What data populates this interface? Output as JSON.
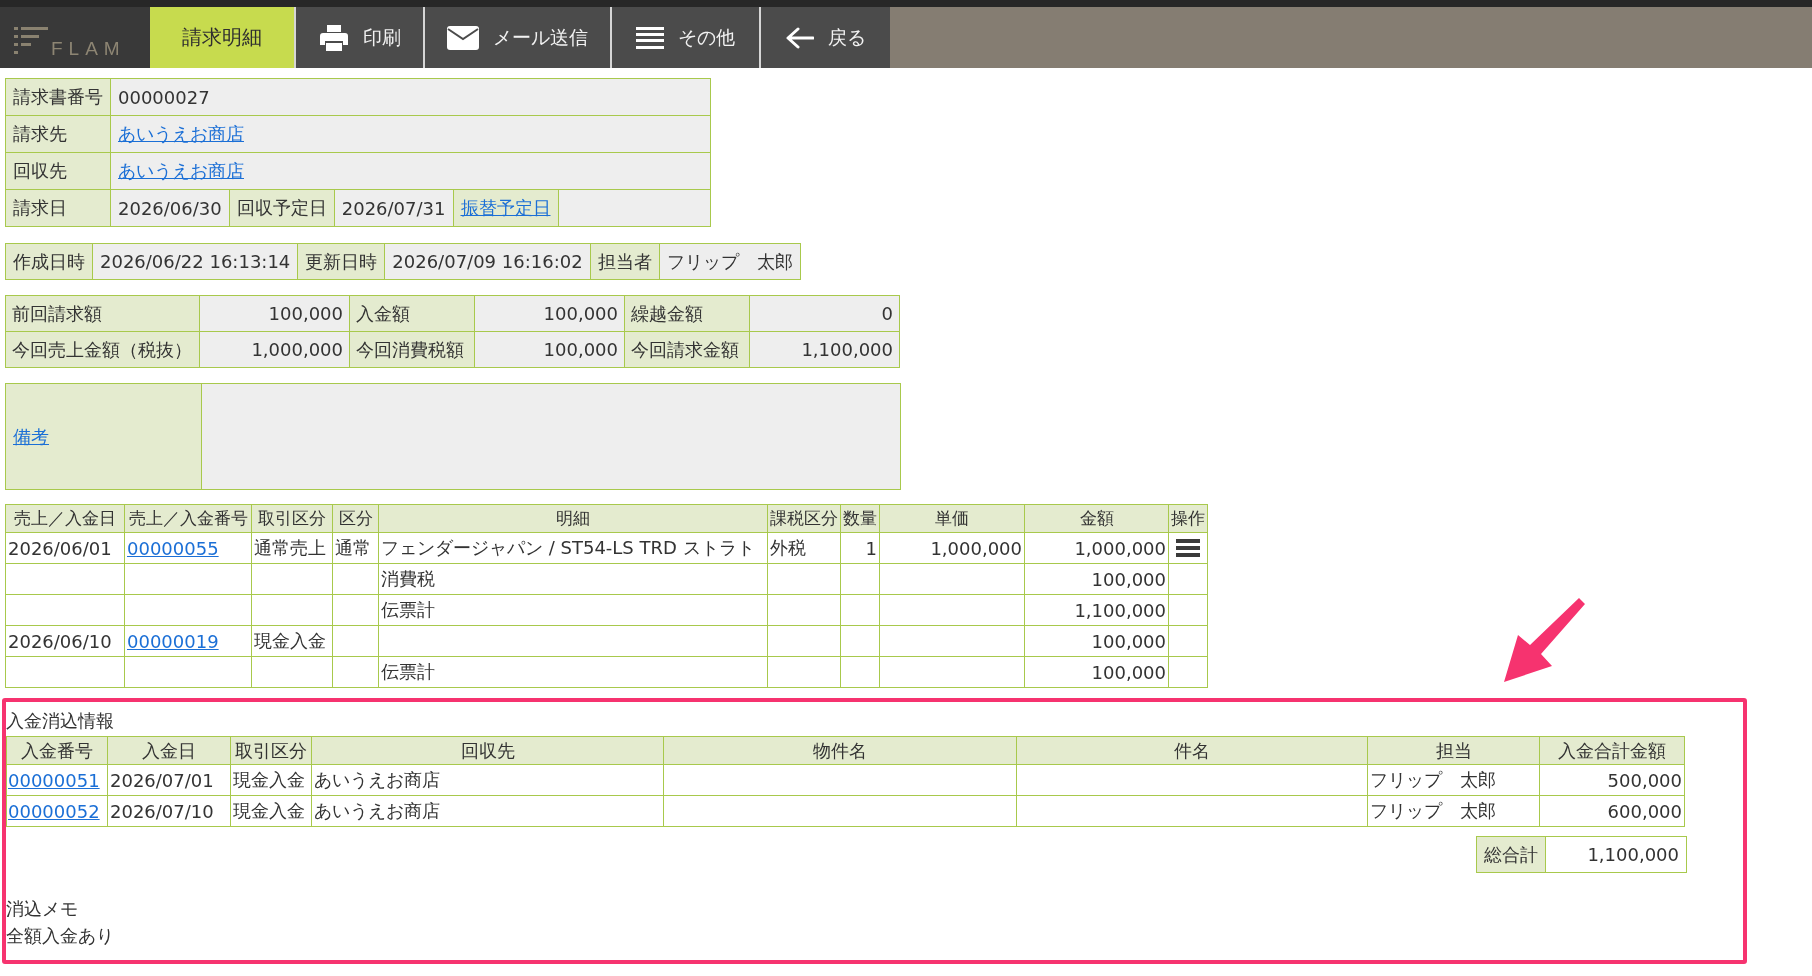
{
  "toolbar": {
    "logo": "FLAM",
    "tab": {
      "label": "請求明細",
      "selected": true
    },
    "buttons": [
      {
        "kind": "print",
        "label": "印刷"
      },
      {
        "kind": "mail",
        "label": "メール送信"
      },
      {
        "kind": "more",
        "label": "その他"
      },
      {
        "kind": "back",
        "label": "戻る"
      }
    ]
  },
  "invoice": {
    "rows": [
      [
        {
          "kind": "label",
          "text": "請求書番号"
        },
        {
          "kind": "value",
          "text": "00000027",
          "colspan": 5
        }
      ],
      [
        {
          "kind": "label",
          "text": "請求先"
        },
        {
          "kind": "link",
          "text": "あいうえお商店",
          "colspan": 5
        }
      ],
      [
        {
          "kind": "label",
          "text": "回収先"
        },
        {
          "kind": "link",
          "text": "あいうえお商店",
          "colspan": 5
        }
      ],
      [
        {
          "kind": "label",
          "text": "請求日"
        },
        {
          "kind": "value",
          "text": "2026/06/30"
        },
        {
          "kind": "label",
          "text": "回収予定日"
        },
        {
          "kind": "value",
          "text": "2026/07/31"
        },
        {
          "kind": "link_label",
          "text": "振替予定日"
        },
        {
          "kind": "value"
        }
      ]
    ]
  },
  "record": [
    {
      "kind": "label",
      "text": "作成日時"
    },
    {
      "kind": "value",
      "text": "2026/06/22 16:13:14"
    },
    {
      "kind": "label",
      "text": "更新日時"
    },
    {
      "kind": "value",
      "text": "2026/07/09 16:16:02"
    },
    {
      "kind": "label",
      "text": "担当者"
    },
    {
      "kind": "value",
      "text": "フリップ　太郎"
    }
  ],
  "totals": {
    "rows": [
      [
        {
          "kind": "label",
          "text": "前回請求額"
        },
        {
          "kind": "amount",
          "text": "100,000"
        },
        {
          "kind": "label",
          "text": "入金額"
        },
        {
          "kind": "amount",
          "text": "100,000"
        },
        {
          "kind": "label",
          "text": "繰越金額"
        },
        {
          "kind": "amount",
          "text": "0"
        }
      ],
      [
        {
          "kind": "label",
          "text": "今回売上金額（税抜）"
        },
        {
          "kind": "amount",
          "text": "1,000,000"
        },
        {
          "kind": "label",
          "text": "今回消費税額"
        },
        {
          "kind": "amount",
          "text": "100,000"
        },
        {
          "kind": "label",
          "text": "今回請求金額"
        },
        {
          "kind": "amount",
          "text": "1,100,000"
        }
      ]
    ]
  },
  "remarks": {
    "label": "備考"
  },
  "lines": {
    "columns": [
      "売上／入金日",
      "売上／入金番号",
      "取引区分",
      "区分",
      "明細",
      "課税区分",
      "数量",
      "単価",
      "金額",
      "操作"
    ],
    "rows": [
      {
        "date": "2026/06/01",
        "number": "00000055",
        "deal_type": "通常売上",
        "category": "通常",
        "item": "フェンダージャパン / ST54-LS TRD ストラト",
        "tax_type": "外税",
        "quantity": "1",
        "unit_price": "1,000,000",
        "amount": "1,000,000",
        "menu": true
      },
      {
        "item": "消費税",
        "amount": "100,000",
        "menu": false
      },
      {
        "item": "伝票計",
        "amount": "1,100,000",
        "menu": false
      },
      {
        "date": "2026/06/10",
        "number": "00000019",
        "deal_type": "現金入金",
        "amount": "100,000",
        "menu": false
      },
      {
        "item": "伝票計",
        "amount": "100,000",
        "menu": false
      }
    ]
  },
  "payments": {
    "highlighted": true,
    "title": "入金消込情報",
    "columns": [
      "入金番号",
      "入金日",
      "取引区分",
      "回収先",
      "物件名",
      "件名",
      "担当",
      "入金合計金額"
    ],
    "rows": [
      {
        "number": "00000051",
        "date": "2026/07/01",
        "deal_type": "現金入金",
        "collect_from": "あいうえお商店",
        "staff": "フリップ　太郎",
        "total": "500,000"
      },
      {
        "number": "00000052",
        "date": "2026/07/10",
        "deal_type": "現金入金",
        "collect_from": "あいうえお商店",
        "staff": "フリップ　太郎",
        "total": "600,000"
      }
    ],
    "grand_total": {
      "label": "総合計",
      "value": "1,100,000"
    },
    "memo": {
      "label": "消込メモ",
      "text": "全額入金あり"
    }
  }
}
